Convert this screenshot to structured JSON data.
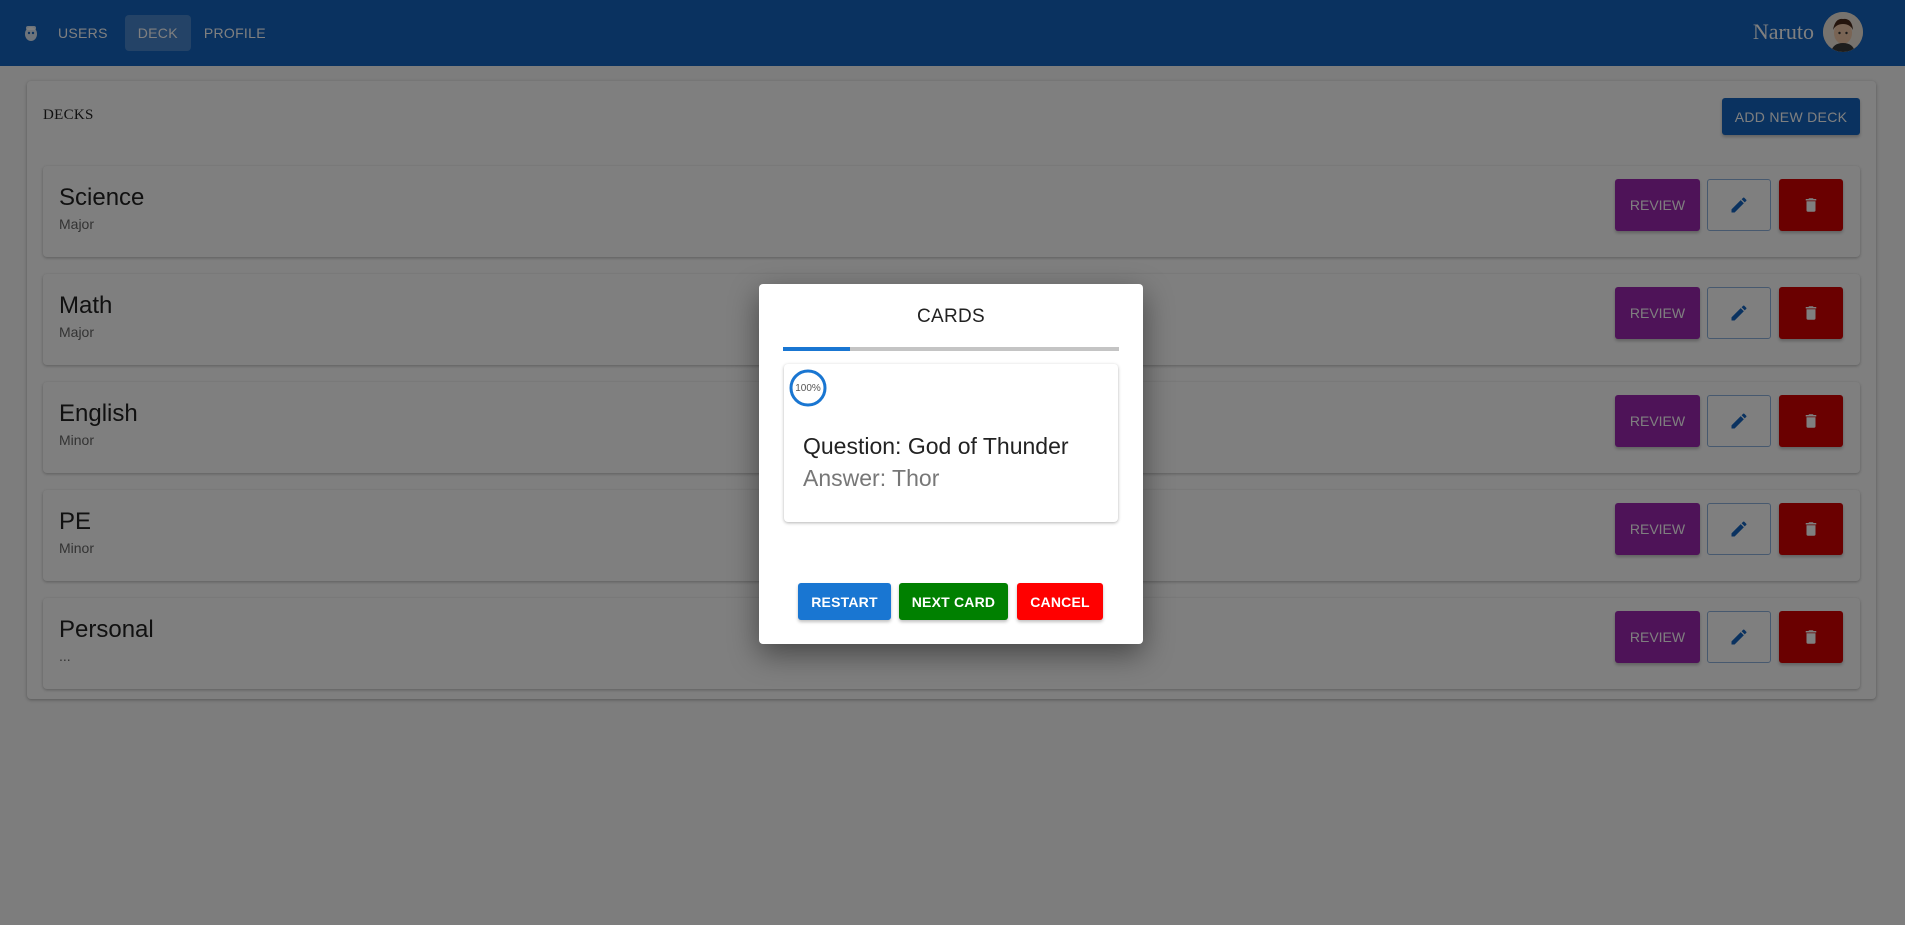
{
  "nav": {
    "items": [
      {
        "label": "USERS"
      },
      {
        "label": "DECK"
      },
      {
        "label": "PROFILE"
      }
    ],
    "user_name": "Naruto"
  },
  "main": {
    "title": "DECKS",
    "add_label": "ADD NEW DECK",
    "decks": [
      {
        "name": "Science",
        "category": "Major",
        "review_label": "REVIEW"
      },
      {
        "name": "Math",
        "category": "Major",
        "review_label": "REVIEW"
      },
      {
        "name": "English",
        "category": "Minor",
        "review_label": "REVIEW"
      },
      {
        "name": "PE",
        "category": "Minor",
        "review_label": "REVIEW"
      },
      {
        "name": "Personal",
        "category": "...",
        "review_label": "REVIEW"
      }
    ]
  },
  "dialog": {
    "title": "CARDS",
    "progress_fraction": 0.2,
    "card": {
      "percent_label": "100%",
      "percent_value": 100,
      "question": "Question: God of Thunder",
      "answer": "Answer: Thor"
    },
    "restart_label": "RESTART",
    "next_label": "NEXT CARD",
    "cancel_label": "CANCEL"
  },
  "colors": {
    "appbar": "#1565c0",
    "review": "#9c27b0",
    "delete": "#d50000",
    "restart": "#1976d2",
    "next": "#008000",
    "cancel": "#ff0000"
  }
}
